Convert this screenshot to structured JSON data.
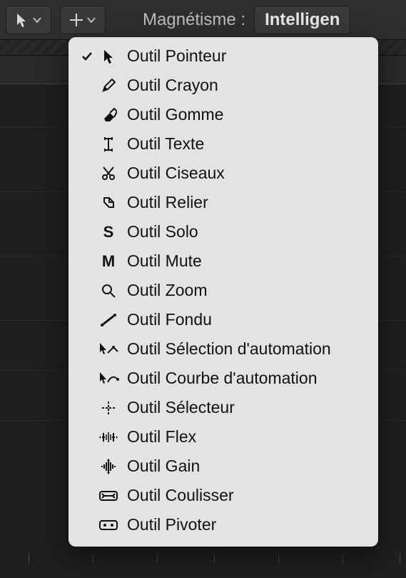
{
  "toolbar": {
    "snap_label": "Magnétisme :",
    "snap_value": "Intelligen"
  },
  "menu": {
    "selected_index": 0,
    "items": [
      {
        "icon": "pointer",
        "label": "Outil Pointeur"
      },
      {
        "icon": "pencil",
        "label": "Outil Crayon"
      },
      {
        "icon": "eraser",
        "label": "Outil Gomme"
      },
      {
        "icon": "text",
        "label": "Outil Texte"
      },
      {
        "icon": "scissors",
        "label": "Outil Ciseaux"
      },
      {
        "icon": "glue",
        "label": "Outil Relier"
      },
      {
        "icon": "solo",
        "label": "Outil Solo"
      },
      {
        "icon": "mute",
        "label": "Outil Mute"
      },
      {
        "icon": "zoom",
        "label": "Outil Zoom"
      },
      {
        "icon": "fade",
        "label": "Outil Fondu"
      },
      {
        "icon": "automation-select",
        "label": "Outil Sélection d'automation"
      },
      {
        "icon": "automation-curve",
        "label": "Outil Courbe d'automation"
      },
      {
        "icon": "marquee",
        "label": "Outil Sélecteur"
      },
      {
        "icon": "flex",
        "label": "Outil Flex"
      },
      {
        "icon": "gain",
        "label": "Outil Gain"
      },
      {
        "icon": "slip",
        "label": "Outil Coulisser"
      },
      {
        "icon": "rotate",
        "label": "Outil Pivoter"
      }
    ]
  }
}
